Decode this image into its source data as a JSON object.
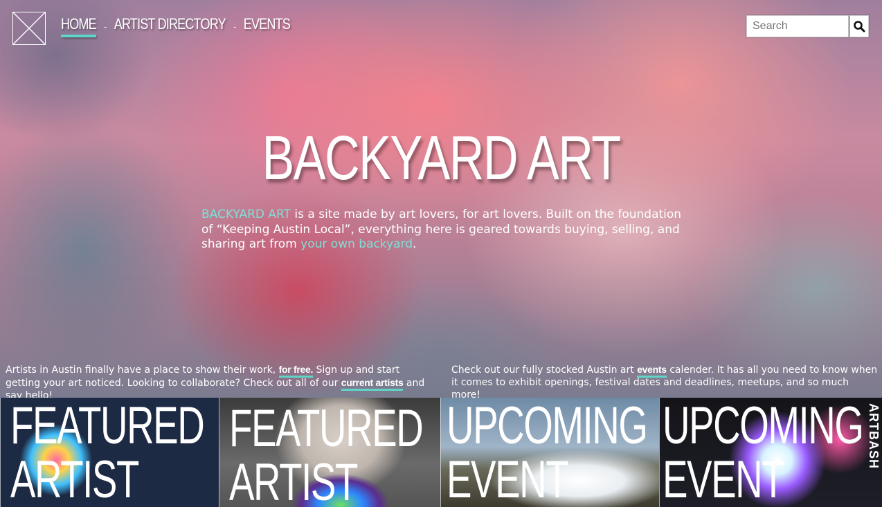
{
  "nav": {
    "items": [
      {
        "label": "HOME",
        "active": true
      },
      {
        "label": "ARTIST DIRECTORY",
        "active": false
      },
      {
        "label": "EVENTS",
        "active": false
      }
    ],
    "separator": "-"
  },
  "search": {
    "placeholder": "Search",
    "value": ""
  },
  "hero": {
    "title": "BACKYARD ART",
    "intro": {
      "brand": "BACKYARD ART",
      "text1": " is a site made by art lovers, for art lovers. Built on the foundation of “Keeping Austin Local”, everything here is geared towards buying, selling, and sharing art from ",
      "link": "your own backyard",
      "text2": "."
    }
  },
  "blurbs": {
    "left": {
      "text1": "Artists in Austin finally have a place to show their work, ",
      "link1": "for free.",
      "text2": " Sign up and start getting your art noticed. Looking to collaborate? Check out all of our ",
      "link2": "current artists",
      "text3": " and say hello!"
    },
    "right": {
      "text1": "Check out our fully stocked Austin art ",
      "link1": "events",
      "text2": " calender. It has all you need to know when it comes to exhibit openings, festival dates and deadlines, meetups, and so much more!"
    }
  },
  "tiles": [
    {
      "line1": "FEATURED",
      "line2": "ARTIST"
    },
    {
      "line1": "FEATURED",
      "line2": "ARTIST"
    },
    {
      "line1": "UPCOMING",
      "line2": "EVENT"
    },
    {
      "line1": "UPCOMING",
      "line2": "EVENT",
      "tag": "ARTBASH"
    }
  ],
  "colors": {
    "accent": "#5fd5c8",
    "accent_text": "#7fe0d6"
  }
}
